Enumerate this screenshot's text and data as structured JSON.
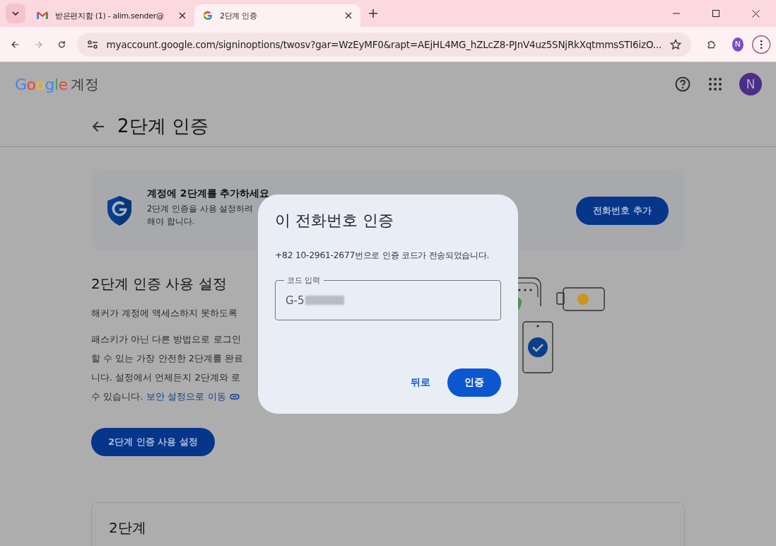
{
  "browser": {
    "tabs": [
      {
        "title": "받은편지함 (1) - alim.sender@",
        "selected": false
      },
      {
        "title": "2단계 인증",
        "selected": true
      }
    ],
    "url": "myaccount.google.com/signinoptions/twosv?gar=WzEyMF0&rapt=AEjHL4MG_hZLcZ8-PJnV4uz5SNjRkXqtmmsSTI6izO...",
    "profile_initial": "N"
  },
  "header": {
    "logo": "Google",
    "product": "계정",
    "avatar": "N"
  },
  "page_title": "2단계 인증",
  "banner": {
    "title": "계정에 2단계를 추가하세요",
    "lines": [
      "2단계 인증을 사용 설정하려",
      "해야 합니다."
    ],
    "button": "전화번호 추가"
  },
  "section": {
    "heading": "2단계 인증 사용 설정",
    "intro": "해커가 계정에 액세스하지 못하도록",
    "lines": [
      "패스키가 아닌 다른 방법으로 로그인",
      "할 수 있는 가장 안전한 2단계를 완료",
      "니다. 설정에서 언제든지 2단계와 로"
    ],
    "last_line": "수 있습니다.",
    "link": "보안 설정으로 이동",
    "button": "2단계 인증 사용 설정"
  },
  "card": {
    "title": "2단계"
  },
  "dialog": {
    "title": "이 전화번호 인증",
    "message": "+82 10-2961-2677번으로 인증 코드가 전송되었습니다.",
    "field_label": "코드 입력",
    "field_value": "G-5",
    "redacted": true,
    "back": "뒤로",
    "confirm": "인증"
  }
}
